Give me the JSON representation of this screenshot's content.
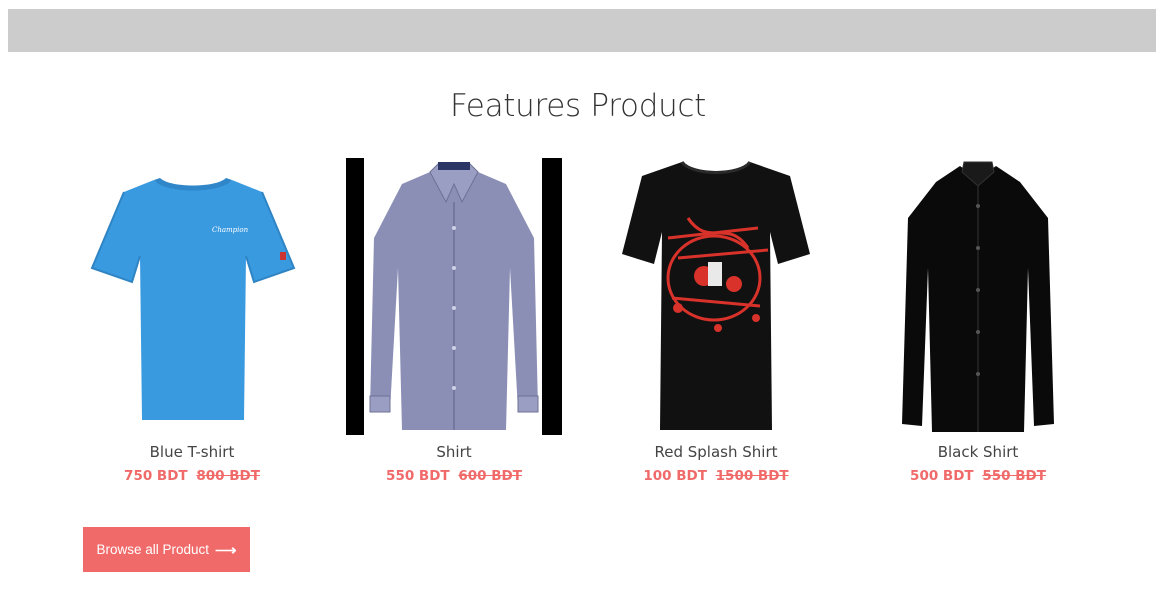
{
  "header": {
    "bar_color": "#cccccc"
  },
  "section": {
    "title": "Features Product"
  },
  "products": [
    {
      "name": "Blue T-shirt",
      "price": "750 BDT",
      "old_price": "800 BDT",
      "image": "blue-tshirt-icon",
      "color": "#3a9ae0"
    },
    {
      "name": "Shirt",
      "price": "550 BDT",
      "old_price": "600 BDT",
      "image": "grey-dress-shirt-icon",
      "color": "#8b8fb5"
    },
    {
      "name": "Red Splash Shirt",
      "price": "100 BDT",
      "old_price": "1500 BDT",
      "image": "black-graphic-tshirt-icon",
      "color": "#111111"
    },
    {
      "name": "Black Shirt",
      "price": "500 BDT",
      "old_price": "550 BDT",
      "image": "black-dress-shirt-icon",
      "color": "#0a0a0a"
    }
  ],
  "browse": {
    "label": "Browse all Product",
    "icon": "arrow-right-icon"
  },
  "colors": {
    "accent": "#f16a6a",
    "price": "#f06a6a"
  }
}
